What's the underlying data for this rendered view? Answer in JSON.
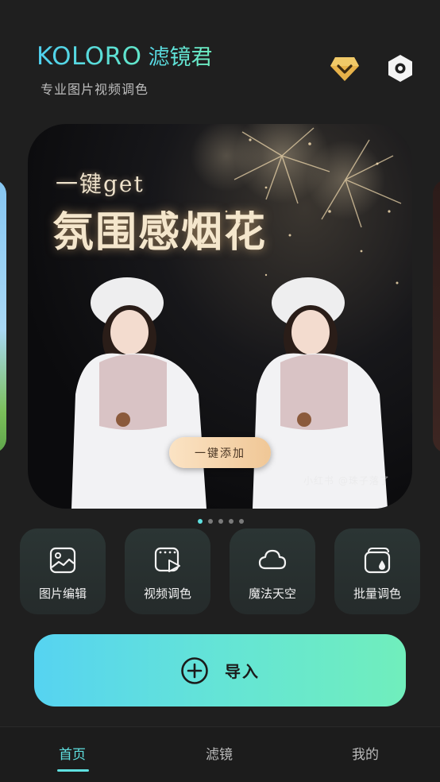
{
  "header": {
    "brand_en": "KOLORO",
    "brand_cn": "滤镜君",
    "subtitle": "专业图片视频调色",
    "icons": {
      "vip": "vip-diamond-icon",
      "settings": "settings-hexagon-icon"
    }
  },
  "banner": {
    "kicker": "一键get",
    "headline": "氛围感烟花",
    "cta_label": "一键添加",
    "watermark": "小红书 @珠子落了",
    "page_count": 5,
    "active_page": 1
  },
  "tools": [
    {
      "label": "图片编辑",
      "icon": "image-edit-icon"
    },
    {
      "label": "视频调色",
      "icon": "video-color-icon"
    },
    {
      "label": "魔法天空",
      "icon": "cloud-icon"
    },
    {
      "label": "批量调色",
      "icon": "batch-color-icon"
    }
  ],
  "import": {
    "label": "导入",
    "icon": "plus-circle-icon"
  },
  "nav": {
    "items": [
      "首页",
      "滤镜",
      "我的"
    ],
    "active": "首页"
  },
  "colors": {
    "accent": "#5fe0e0",
    "background": "#1f1f1f",
    "import_gradient": [
      "#56d3f1",
      "#70eebc"
    ],
    "vip_gold": "#e7b24a"
  }
}
